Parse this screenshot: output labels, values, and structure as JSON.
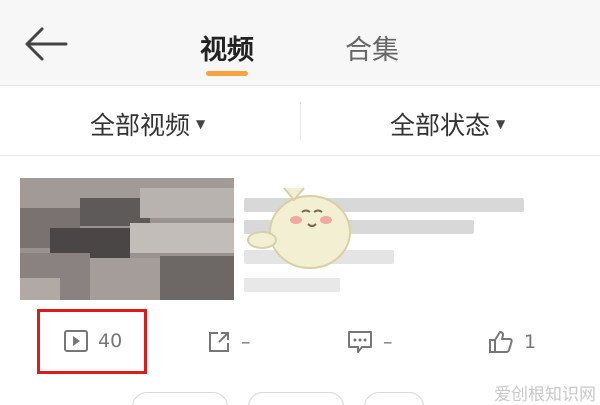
{
  "header": {
    "tabs": [
      {
        "label": "视频",
        "active": true
      },
      {
        "label": "合集",
        "active": false
      }
    ],
    "accent_color": "#f7a23a"
  },
  "filters": {
    "all_videos": "全部视频",
    "all_status": "全部状态"
  },
  "video_item": {
    "stats": {
      "plays": "40",
      "shares": "–",
      "comments": "–",
      "likes": "1"
    }
  },
  "watermark": "爱创根知识网",
  "highlight_color": "#e01a1a"
}
